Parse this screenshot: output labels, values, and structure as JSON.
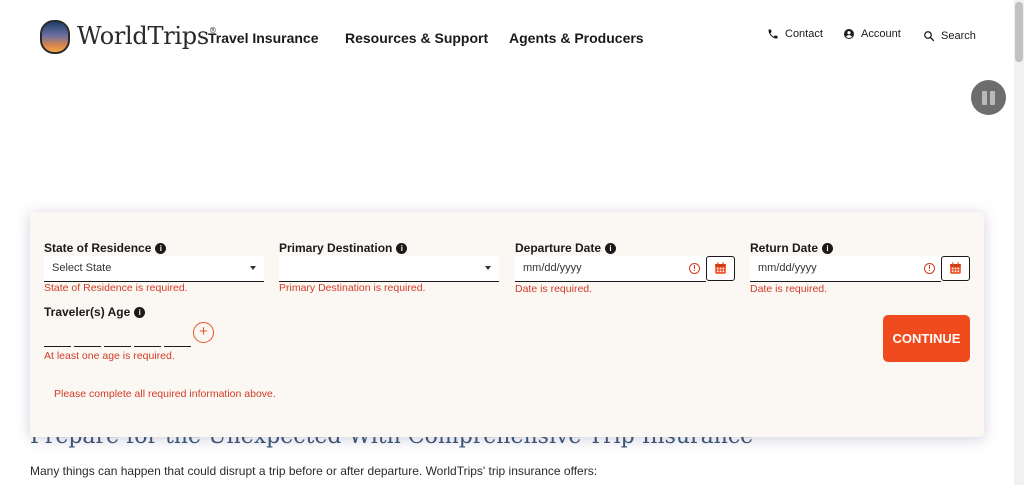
{
  "header": {
    "brand": "WorldTrips",
    "brand_mark": "®",
    "nav": [
      "Travel Insurance",
      "Resources & Support",
      "Agents & Producers"
    ],
    "utility": {
      "contact": "Contact",
      "account": "Account",
      "search": "Search"
    }
  },
  "form": {
    "state": {
      "label": "State of Residence",
      "value": "Select State",
      "error": "State of Residence is required."
    },
    "destination": {
      "label": "Primary Destination",
      "value": "",
      "error": "Primary Destination is required."
    },
    "departure": {
      "label": "Departure Date",
      "placeholder": "mm/dd/yyyy",
      "error": "Date is required."
    },
    "return": {
      "label": "Return Date",
      "placeholder": "mm/dd/yyyy",
      "error": "Date is required."
    },
    "ages": {
      "label": "Traveler(s) Age",
      "error": "At least one age is required.",
      "add_symbol": "+"
    },
    "summary_error": "Please complete all required information above.",
    "continue_label": "CONTINUE"
  },
  "background": {
    "heading": "Prepare for the Unexpected With Comprehensive Trip Insurance",
    "body": "Many things can happen that could disrupt a trip before or after departure. WorldTrips' trip insurance offers:"
  },
  "colors": {
    "accent": "#f04b1f",
    "error": "#d23b26",
    "card_bg": "#fbf8f4",
    "heading": "#33506e"
  }
}
